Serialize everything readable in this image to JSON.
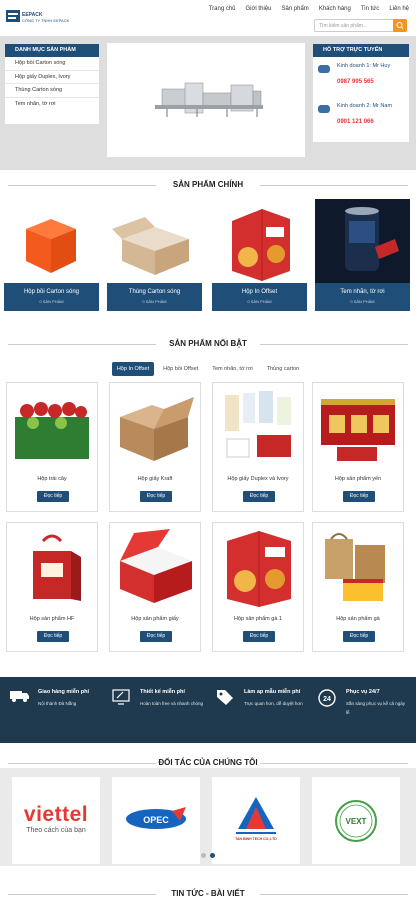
{
  "header": {
    "logo_text": "EEPACK CÔNG TY TNHH EEPACK",
    "nav": [
      "Trang chủ",
      "Giới thiệu",
      "Sản phẩm",
      "Khách hàng",
      "Tin tức",
      "Liên hệ"
    ],
    "search_placeholder": "Tìm kiếm sản phẩm..."
  },
  "sidebar": {
    "title": "DANH MỤC SẢN PHẨM",
    "items": [
      "Hộp bồi Carton sóng",
      "Hộp giấy Duplex, Ivory",
      "Thùng Carton sóng",
      "Tem nhãn, tờ rơi"
    ]
  },
  "support": {
    "title": "HỖ TRỢ TRỰC TUYẾN",
    "contacts": [
      {
        "name": "Kinh doanh 1: Mr Huy",
        "phone": "0987 995 565"
      },
      {
        "name": "Kinh doanh 2: Mr Nam",
        "phone": "0901 121 066"
      }
    ]
  },
  "main_products": {
    "title": "SẢN PHẨM CHÍNH",
    "items": [
      {
        "name": "Hộp bồi Carton sóng",
        "count": "0 SẢN PHẨM"
      },
      {
        "name": "Thùng Carton sóng",
        "count": "0 SẢN PHẨM"
      },
      {
        "name": "Hộp In Offset",
        "count": "0 SẢN PHẨM"
      },
      {
        "name": "Tem nhãn, tờ rơi",
        "count": "0 SẢN PHẨM"
      }
    ]
  },
  "featured": {
    "title": "SẢN PHẨM NỔI BẬT",
    "tabs": [
      "Hộp In Offset",
      "Hộp bồi Offset",
      "Tem nhãn, tờ rơi",
      "Thùng carton"
    ],
    "button_label": "Đọc tiếp",
    "items": [
      "Hộp trái cây",
      "Hộp giấy Kraft",
      "Hộp giấy Duplex và Ivory",
      "Hộp sản phẩm yến",
      "Hộp sản phẩm HF",
      "Hộp sản phẩm giấy",
      "Hộp sản phẩm gà 1",
      "Hộp sản phẩm gà"
    ]
  },
  "features": [
    {
      "title": "Giao hàng miễn phí",
      "sub": "Nội thành Đà Nẵng"
    },
    {
      "title": "Thiết kế miễn phí",
      "sub": "Hoàn toàn free và nhanh chóng"
    },
    {
      "title": "Làm ap mẫu miễn phí",
      "sub": "Trực quan hơn, dễ duyệt hơn"
    },
    {
      "title": "Phục vụ 24/7",
      "sub": "Sẵn sàng phục vụ kể cả ngày lễ"
    }
  ],
  "partners": {
    "title": "ĐỐI TÁC CỦA CHÚNG TÔI",
    "logos": [
      {
        "text": "viettel",
        "tagline": "Theo cách của bạn"
      },
      {
        "text": "OPEC",
        "tagline": ""
      },
      {
        "text": "TAN BINH TECH CO.,LTD",
        "tagline": ""
      },
      {
        "text": "VEXT",
        "tagline": ""
      }
    ]
  },
  "news": {
    "title": "TIN TỨC - BÀI VIẾT"
  },
  "colors": {
    "primary": "#1f4e79",
    "accent": "#f7941d",
    "dark_band": "#1f3a4f",
    "phone": "#e53935"
  }
}
